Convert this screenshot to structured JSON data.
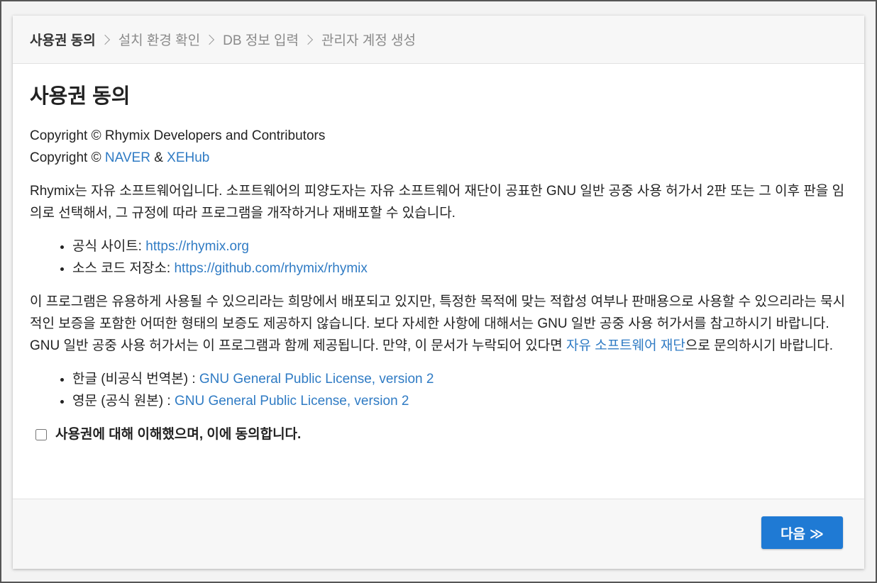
{
  "breadcrumb": {
    "steps": [
      "사용권 동의",
      "설치 환경 확인",
      "DB 정보 입력",
      "관리자 계정 생성"
    ]
  },
  "main": {
    "title": "사용권 동의",
    "copyright1": "Copyright © Rhymix Developers and Contributors",
    "copyright2_prefix": "Copyright © ",
    "copyright2_link1": "NAVER",
    "copyright2_amp": " & ",
    "copyright2_link2": "XEHub",
    "intro": "Rhymix는 자유 소프트웨어입니다. 소프트웨어의 피양도자는 자유 소프트웨어 재단이 공표한 GNU 일반 공중 사용 허가서 2판 또는 그 이후 판을 임의로 선택해서, 그 규정에 따라 프로그램을 개작하거나 재배포할 수 있습니다.",
    "links": [
      {
        "label": "공식 사이트: ",
        "url": "https://rhymix.org"
      },
      {
        "label": "소스 코드 저장소: ",
        "url": "https://github.com/rhymix/rhymix"
      }
    ],
    "warranty_text": "이 프로그램은 유용하게 사용될 수 있으리라는 희망에서 배포되고 있지만, 특정한 목적에 맞는 적합성 여부나 판매용으로 사용할 수 있으리라는 묵시적인 보증을 포함한 어떠한 형태의 보증도 제공하지 않습니다. 보다 자세한 사항에 대해서는 GNU 일반 공중 사용 허가서를 참고하시기 바랍니다. GNU 일반 공중 사용 허가서는 이 프로그램과 함께 제공됩니다. 만약, 이 문서가 누락되어 있다면 ",
    "fsf_link": "자유 소프트웨어 재단",
    "warranty_suffix": "으로 문의하시기 바랍니다.",
    "licenses": [
      {
        "label": "한글 (비공식 번역본) : ",
        "link": "GNU General Public License, version 2"
      },
      {
        "label": "영문 (공식 원본) : ",
        "link": "GNU General Public License, version 2"
      }
    ],
    "agree_label": "사용권에 대해 이해했으며, 이에 동의합니다."
  },
  "footer": {
    "next_label": "다음",
    "next_icon": "≫"
  },
  "colors": {
    "link": "#2f7bc4",
    "primary_button": "#1f7ad4"
  }
}
